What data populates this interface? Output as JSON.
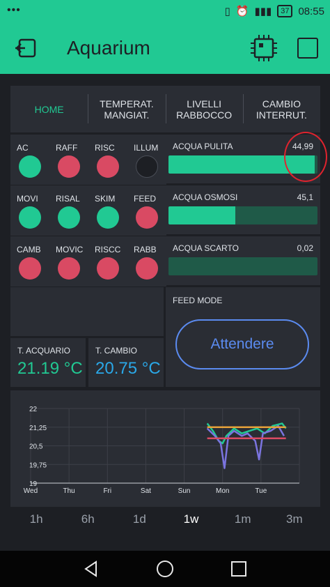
{
  "status": {
    "time": "08:55",
    "battery": "37"
  },
  "app": {
    "title": "Aquarium"
  },
  "tabs": [
    {
      "line1": "HOME",
      "line2": ""
    },
    {
      "line1": "TEMPERAT.",
      "line2": "MANGIAT."
    },
    {
      "line1": "LIVELLI",
      "line2": "RABBOCCO"
    },
    {
      "line1": "CAMBIO",
      "line2": "INTERRUT."
    }
  ],
  "leds": [
    {
      "label": "AC",
      "state": "green"
    },
    {
      "label": "RAFF",
      "state": "red"
    },
    {
      "label": "RISC",
      "state": "red"
    },
    {
      "label": "ILLUM",
      "state": "off"
    },
    {
      "label": "MOVI",
      "state": "green"
    },
    {
      "label": "RISAL",
      "state": "green"
    },
    {
      "label": "SKIM",
      "state": "green"
    },
    {
      "label": "FEED",
      "state": "red"
    },
    {
      "label": "CAMB",
      "state": "red"
    },
    {
      "label": "MOVIC",
      "state": "red"
    },
    {
      "label": "RISCC",
      "state": "red"
    },
    {
      "label": "RABB",
      "state": "red"
    }
  ],
  "levels": [
    {
      "label": "ACQUA PULITA",
      "value": "44,99",
      "fill": 0.98
    },
    {
      "label": "ACQUA OSMOSI",
      "value": "45,1",
      "fill": 0.45
    },
    {
      "label": "ACQUA SCARTO",
      "value": "0,02",
      "fill": 0.0
    }
  ],
  "feed": {
    "label": "FEED MODE",
    "button": "Attendere"
  },
  "temps": [
    {
      "label": "T. ACQUARIO",
      "value": "21.19 °C",
      "color": "#21c993"
    },
    {
      "label": "T. CAMBIO",
      "value": "20.75 °C",
      "color": "#2aa8e8"
    }
  ],
  "chart_data": {
    "type": "line",
    "x": [
      "Wed",
      "Thu",
      "Fri",
      "Sat",
      "Sun",
      "Mon",
      "Tue"
    ],
    "y_ticks": [
      "22",
      "21,25",
      "20,5",
      "19,75",
      "19"
    ],
    "ylim": [
      19,
      22
    ],
    "series": [
      {
        "color": "#21c993",
        "points": [
          [
            4.6,
            21.4
          ],
          [
            4.75,
            21.1
          ],
          [
            4.9,
            20.7
          ],
          [
            5.0,
            20.6
          ],
          [
            5.1,
            20.9
          ],
          [
            5.3,
            21.2
          ],
          [
            5.5,
            21.0
          ],
          [
            5.7,
            21.1
          ],
          [
            5.9,
            21.2
          ],
          [
            6.1,
            21.0
          ],
          [
            6.3,
            21.3
          ],
          [
            6.55,
            21.4
          ],
          [
            6.65,
            21.2
          ]
        ]
      },
      {
        "color": "#7b74e0",
        "points": [
          [
            4.6,
            21.2
          ],
          [
            4.8,
            20.9
          ],
          [
            4.95,
            20.6
          ],
          [
            5.05,
            19.6
          ],
          [
            5.15,
            20.9
          ],
          [
            5.3,
            21.1
          ],
          [
            5.5,
            20.9
          ],
          [
            5.65,
            21.0
          ],
          [
            5.85,
            20.7
          ],
          [
            5.95,
            19.95
          ],
          [
            6.05,
            21.0
          ],
          [
            6.25,
            21.1
          ],
          [
            6.45,
            21.3
          ],
          [
            6.6,
            20.9
          ]
        ]
      },
      {
        "color": "#e6a13a",
        "points": [
          [
            4.6,
            21.25
          ],
          [
            6.65,
            21.25
          ]
        ]
      },
      {
        "color": "#d94a63",
        "points": [
          [
            4.6,
            20.8
          ],
          [
            6.65,
            20.8
          ]
        ]
      }
    ]
  },
  "ranges": [
    "1h",
    "6h",
    "1d",
    "1w",
    "1m",
    "3m"
  ],
  "active_range": "1w"
}
